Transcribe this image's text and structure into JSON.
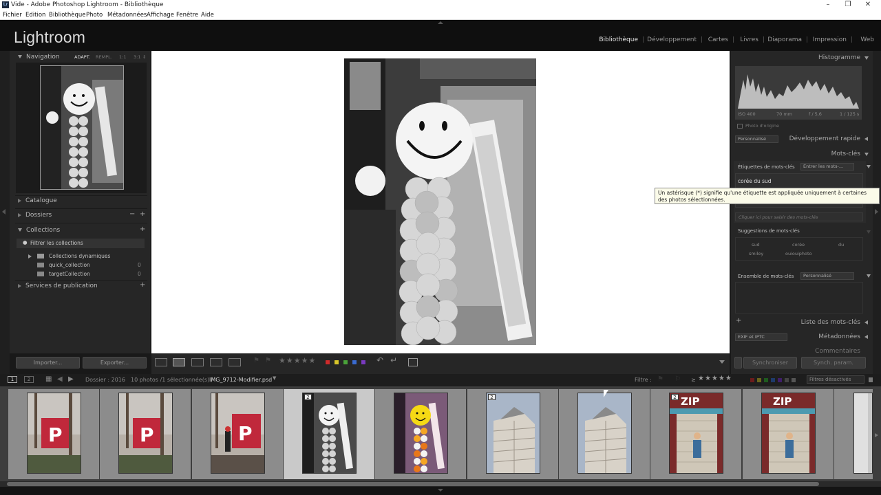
{
  "window": {
    "title": "Vide - Adobe Photoshop Lightroom - Bibliothèque",
    "app_icon": "Lr"
  },
  "menu": [
    "Fichier",
    "Edition",
    "Bibliothèque",
    "Photo",
    "Métadonnées",
    "Affichage",
    "Fenêtre",
    "Aide"
  ],
  "logo": "Lightroom",
  "modules": [
    {
      "label": "Bibliothèque",
      "active": true
    },
    {
      "label": "Développement",
      "active": false
    },
    {
      "label": "Cartes",
      "active": false
    },
    {
      "label": "Livres",
      "active": false
    },
    {
      "label": "Diaporama",
      "active": false
    },
    {
      "label": "Impression",
      "active": false
    },
    {
      "label": "Web",
      "active": false
    }
  ],
  "left": {
    "navigator": {
      "title": "Navigation",
      "options": [
        "ADAPT.",
        "REMPL.",
        "1:1",
        "3:1"
      ]
    },
    "catalogue": "Catalogue",
    "dossiers": "Dossiers",
    "dossiers_minus": "−",
    "collections": "Collections",
    "collections_filter": "Filtrer les collections",
    "collection_items": [
      {
        "label": "Collections dynamiques",
        "count": ""
      },
      {
        "label": "quick_collection",
        "count": "0"
      },
      {
        "label": "targetCollection",
        "count": "0"
      }
    ],
    "services": "Services de publication",
    "import_btn": "Importer...",
    "export_btn": "Exporter..."
  },
  "right": {
    "histogram": "Histogramme",
    "hist_info": [
      "ISO 400",
      "70 mm",
      "f / 5,6",
      "1 / 125 s"
    ],
    "original_photo": "Photo d'origine",
    "quick_dev_preset": "Personnalisé",
    "quick_dev": "Développement rapide",
    "keywords": "Mots-clés",
    "keyword_tags_label": "Étiquettes de mots-clés",
    "keyword_tags_dropdown": "Entrer les mots-...",
    "keyword_value": "corée du sud",
    "keyword_placeholder": "Cliquer ici pour saisir des mots-clés",
    "suggestions_title": "Suggestions de mots-clés",
    "suggestions": [
      "sud",
      "corée",
      "du",
      "smiley",
      "ouiouiphoto",
      ""
    ],
    "keyword_set_label": "Ensemble de mots-clés",
    "keyword_set_value": "Personnalisé",
    "keyword_list": "Liste des mots-clés",
    "keyword_list_plus": "+",
    "metadata_preset": "EXIF et IPTC",
    "metadata": "Métadonnées",
    "comments": "Commentaires",
    "sync_btn": "Synchroniser",
    "sync_settings_btn": "Synch. param."
  },
  "tooltip": "Un astérisque (*) signifie qu'une étiquette est appliquée uniquement à certaines des photos sélectionnées.",
  "toolbar": {
    "stars": "★★★★★"
  },
  "filmbar": {
    "page1": "1",
    "page2": "2",
    "source": "Dossier : 2016",
    "count": "10 photos /1 sélectionnée(s) /",
    "filename": "IMG_9712-Modifier.psd",
    "filter_label": "Filtre :",
    "stars_prefix": "≥",
    "stars": "★★★★★",
    "filters_off": "Filtres désactivés"
  },
  "filmstrip": [
    {
      "kind": "p",
      "selected": false,
      "badge": ""
    },
    {
      "kind": "p",
      "selected": false,
      "badge": ""
    },
    {
      "kind": "p-person",
      "selected": false,
      "badge": ""
    },
    {
      "kind": "balloon-bw",
      "selected": true,
      "badge": "2"
    },
    {
      "kind": "balloon-color",
      "selected": false,
      "badge": ""
    },
    {
      "kind": "building",
      "selected": false,
      "badge": "2"
    },
    {
      "kind": "building",
      "selected": false,
      "badge": ""
    },
    {
      "kind": "zip",
      "selected": false,
      "badge": "2"
    },
    {
      "kind": "zip",
      "selected": false,
      "badge": ""
    },
    {
      "kind": "partial",
      "selected": false,
      "badge": ""
    }
  ],
  "accent": {
    "panel": "#262626",
    "active_text": "#e8e8e8"
  }
}
